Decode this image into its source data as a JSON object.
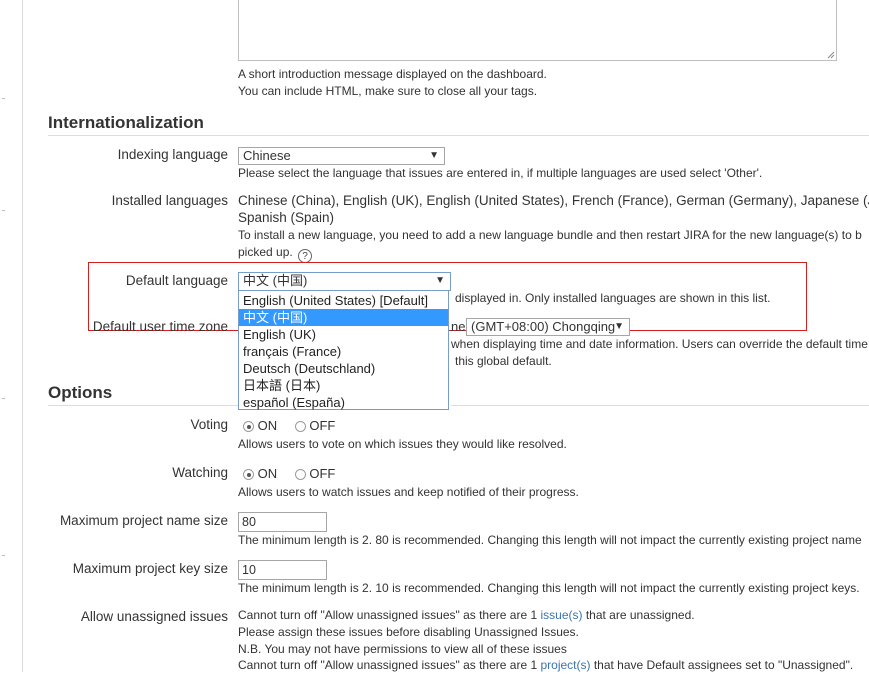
{
  "intro_help": {
    "line1": "A short introduction message displayed on the dashboard.",
    "line2": "You can include HTML, make sure to close all your tags."
  },
  "internationalization": {
    "title": "Internationalization",
    "indexing": {
      "label": "Indexing language",
      "value": "Chinese",
      "help": "Please select the language that issues are entered in, if multiple languages are used select 'Other'."
    },
    "installed": {
      "label": "Installed languages",
      "line1": "Chinese (China), English (UK), English (United States), French (France), German (Germany), Japanese (Japa",
      "line2": "Spanish (Spain)",
      "help1": "To install a new language, you need to add a new language bundle and then restart JIRA for the new language(s) to b",
      "help2": "picked up."
    },
    "default_language": {
      "label": "Default language",
      "value": "中文 (中国)",
      "help": "displayed in. Only installed languages are shown in this list.",
      "options": [
        "English (United States) [Default]",
        "中文 (中国)",
        "English (UK)",
        "français (France)",
        "Deutsch (Deutschland)",
        "日本語 (日本)",
        "español (España)"
      ],
      "selected_index": 1
    },
    "time_zone": {
      "label": "Default user time zone",
      "prefix": "ne",
      "value": "(GMT+08:00) Chongqing",
      "help1": "when displaying time and date information. Users can override the default time",
      "help2": "this global default."
    }
  },
  "options": {
    "title": "Options",
    "voting": {
      "label": "Voting",
      "on": "ON",
      "off": "OFF",
      "selected": "ON",
      "help": "Allows users to vote on which issues they would like resolved."
    },
    "watching": {
      "label": "Watching",
      "on": "ON",
      "off": "OFF",
      "selected": "ON",
      "help": "Allows users to watch issues and keep notified of their progress."
    },
    "max_project_name": {
      "label": "Maximum project name size",
      "value": "80",
      "help": "The minimum length is 2. 80 is recommended. Changing this length will not impact the currently existing project name"
    },
    "max_project_key": {
      "label": "Maximum project key size",
      "value": "10",
      "help": "The minimum length is 2. 10 is recommended. Changing this length will not impact the currently existing project keys."
    },
    "unassigned": {
      "label": "Allow unassigned issues",
      "line1_pre": "Cannot turn off \"Allow unassigned issues\" as there are 1 ",
      "line1_link": "issue(s)",
      "line1_post": " that are unassigned.",
      "line2": "Please assign these issues before disabling Unassigned Issues.",
      "line3": "N.B. You may not have permissions to view all of these issues",
      "line4_pre": "Cannot turn off \"Allow unassigned issues\" as there are 1 ",
      "line4_link": "project(s)",
      "line4_post": " that have Default assignees set to \"Unassigned\"."
    }
  },
  "colors": {
    "link": "#3b73af",
    "highlight": "#d21f1f",
    "dropdown_selected": "#3399ff"
  }
}
